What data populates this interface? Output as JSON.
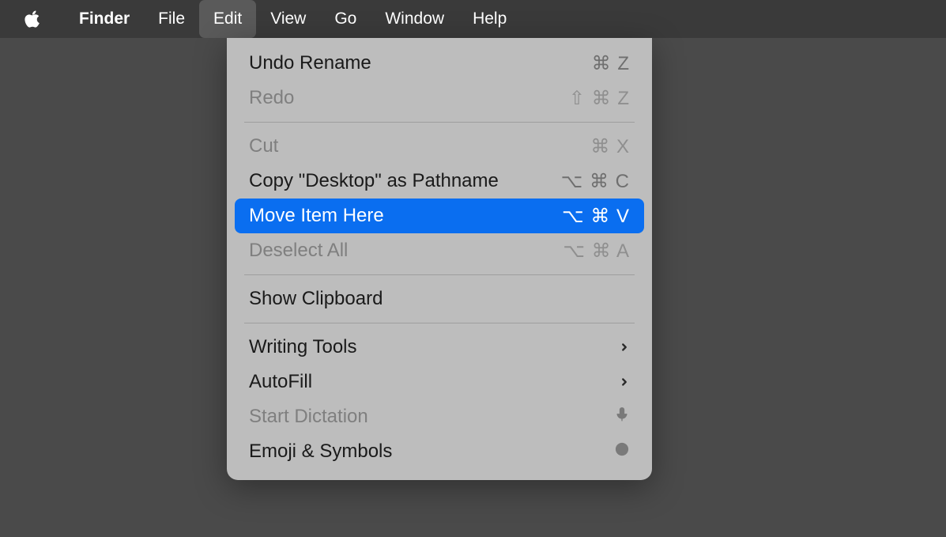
{
  "menubar": {
    "app": "Finder",
    "items": [
      "File",
      "Edit",
      "View",
      "Go",
      "Window",
      "Help"
    ],
    "activeIndex": 1
  },
  "dropdown": {
    "groups": [
      [
        {
          "label": "Undo Rename",
          "shortcut": "⌘ Z",
          "disabled": false
        },
        {
          "label": "Redo",
          "shortcut": "⇧ ⌘ Z",
          "disabled": true
        }
      ],
      [
        {
          "label": "Cut",
          "shortcut": "⌘ X",
          "disabled": true
        },
        {
          "label": "Copy \"Desktop\" as Pathname",
          "shortcut": "⌥ ⌘ C",
          "disabled": false
        },
        {
          "label": "Move Item Here",
          "shortcut": "⌥ ⌘ V",
          "disabled": false,
          "highlighted": true
        },
        {
          "label": "Deselect All",
          "shortcut": "⌥ ⌘ A",
          "disabled": true
        }
      ],
      [
        {
          "label": "Show Clipboard",
          "shortcut": "",
          "disabled": false
        }
      ],
      [
        {
          "label": "Writing Tools",
          "submenu": true,
          "disabled": false
        },
        {
          "label": "AutoFill",
          "submenu": true,
          "disabled": false
        },
        {
          "label": "Start Dictation",
          "icon": "mic",
          "disabled": true
        },
        {
          "label": "Emoji & Symbols",
          "icon": "globe",
          "disabled": false
        }
      ]
    ]
  }
}
